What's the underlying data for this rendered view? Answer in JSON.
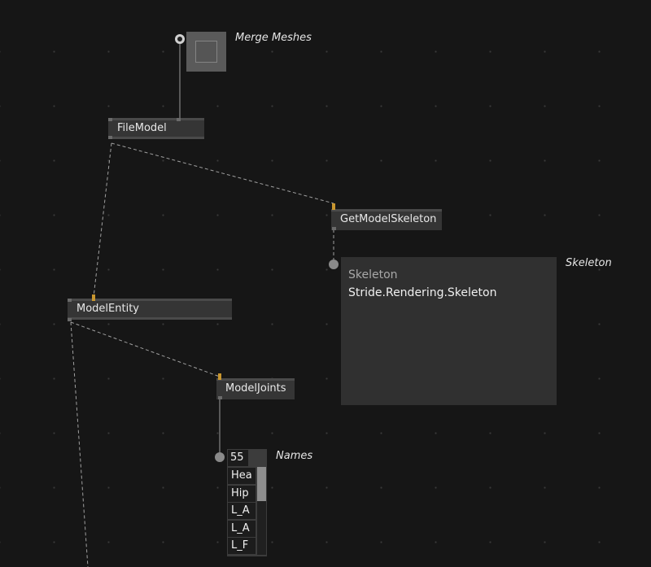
{
  "nodes": {
    "merge_meshes": {
      "label": "Merge Meshes"
    },
    "file_model": {
      "label": "FileModel"
    },
    "get_model_skeleton": {
      "label": "GetModelSkeleton"
    },
    "skeleton": {
      "label": "Skeleton",
      "inspector_title": "Skeleton",
      "inspector_value": "Stride.Rendering.Skeleton"
    },
    "model_entity": {
      "label": "ModelEntity"
    },
    "model_joints": {
      "label": "ModelJoints"
    },
    "names": {
      "label": "Names",
      "count": "55",
      "items": [
        "Hea",
        "Hip",
        "L_A",
        "L_A",
        "L_F"
      ]
    }
  },
  "colors": {
    "background": "#161616",
    "node": "#353535",
    "pin_active": "#c8962f",
    "link": "#a0a0a0"
  }
}
